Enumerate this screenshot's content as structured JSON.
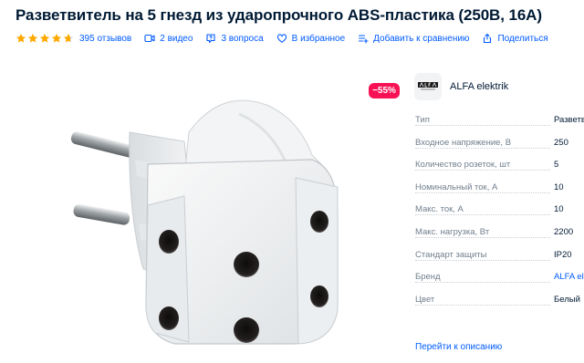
{
  "product": {
    "title": "Разветвитель на 5 гнезд из ударопрочного ABS-пластика (250В, 16А)"
  },
  "actions": {
    "rating": 4.7,
    "reviews": "395 отзывов",
    "videos": "2 видео",
    "questions": "3 вопроса",
    "favorite": "В избранное",
    "compare": "Добавить к сравнению",
    "share": "Поделиться"
  },
  "badge": {
    "discount": "−55%"
  },
  "brand": {
    "name": "ALFA elektrik"
  },
  "specs": [
    {
      "label": "Тип",
      "value": "Разветвитель"
    },
    {
      "label": "Входное напряжение, В",
      "value": "250"
    },
    {
      "label": "Количество розеток, шт",
      "value": "5"
    },
    {
      "label": "Номинальный ток, А",
      "value": "10"
    },
    {
      "label": "Макс. ток, А",
      "value": "10"
    },
    {
      "label": "Макс. нагрузка, Вт",
      "value": "2200"
    },
    {
      "label": "Стандарт защиты",
      "value": "IP20"
    },
    {
      "label": "Бренд",
      "value": "ALFA elektrik"
    },
    {
      "label": "Цвет",
      "value": "Белый"
    }
  ],
  "more_link": "Перейти к описанию",
  "colors": {
    "accent": "#005bff",
    "star": "#ffa800",
    "badge": "#f91155",
    "text": "#001a34",
    "muted": "#707f8d"
  }
}
